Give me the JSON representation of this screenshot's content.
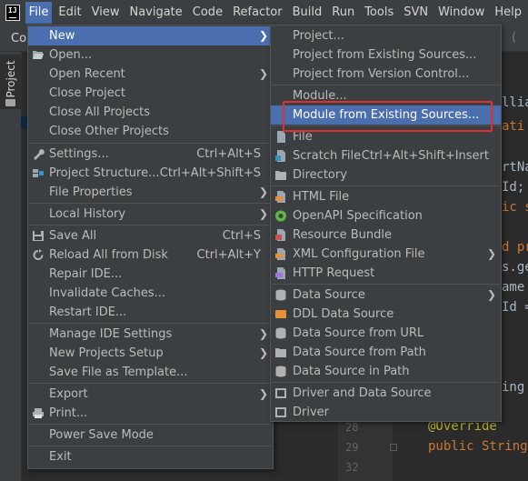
{
  "menubar": {
    "items": [
      "File",
      "Edit",
      "View",
      "Navigate",
      "Code",
      "Refactor",
      "Build",
      "Run",
      "Tools",
      "SVN",
      "Window",
      "Help"
    ],
    "active": "File"
  },
  "toolbar": {
    "left_text": "Co",
    "right_text": "("
  },
  "tool_window": {
    "project_label": "Project"
  },
  "file_menu": {
    "new": "New",
    "open": "Open...",
    "open_recent": "Open Recent",
    "close_project": "Close Project",
    "close_all_projects": "Close All Projects",
    "close_other_projects": "Close Other Projects",
    "settings": "Settings...",
    "settings_shortcut": "Ctrl+Alt+S",
    "project_structure": "Project Structure...",
    "project_structure_shortcut": "Ctrl+Alt+Shift+S",
    "file_properties": "File Properties",
    "local_history": "Local History",
    "save_all": "Save All",
    "save_all_shortcut": "Ctrl+S",
    "reload_all": "Reload All from Disk",
    "reload_all_shortcut": "Ctrl+Alt+Y",
    "repair_ide": "Repair IDE...",
    "invalidate_caches": "Invalidate Caches...",
    "restart_ide": "Restart IDE...",
    "manage_ide_settings": "Manage IDE Settings",
    "new_projects_setup": "New Projects Setup",
    "save_file_as_template": "Save File as Template...",
    "export": "Export",
    "print": "Print...",
    "power_save_mode": "Power Save Mode",
    "exit": "Exit"
  },
  "new_menu": {
    "project": "Project...",
    "project_existing": "Project from Existing Sources...",
    "project_vcs": "Project from Version Control...",
    "module": "Module...",
    "module_existing": "Module from Existing Sources...",
    "file": "File",
    "scratch_file": "Scratch File",
    "scratch_file_shortcut": "Ctrl+Alt+Shift+Insert",
    "directory": "Directory",
    "html_file": "HTML File",
    "openapi_spec": "OpenAPI Specification",
    "resource_bundle": "Resource Bundle",
    "xml_config_file": "XML Configuration File",
    "http_request": "HTTP Request",
    "data_source": "Data Source",
    "ddl_data_source": "DDL Data Source",
    "data_source_url": "Data Source from URL",
    "data_source_path": "Data Source from Path",
    "data_source_in_path": "Data Source in Path",
    "driver_and_data_source": "Driver and Data Source",
    "driver": "Driver"
  },
  "editor": {
    "line_numbers": [
      "28",
      "29",
      "32"
    ],
    "fragments": [
      "llia",
      "ati",
      "rtNa",
      "Id;",
      "ic s",
      "d pr",
      "s.ge",
      "ame",
      "Id =",
      "ing",
      "@Override",
      "public String["
    ]
  },
  "colors": {
    "selection": "#4b6eaf",
    "menu_bg": "#3c3f41",
    "annotation": "#e03030",
    "keyword": "#cc7832",
    "annotation_code": "#bbb529"
  }
}
